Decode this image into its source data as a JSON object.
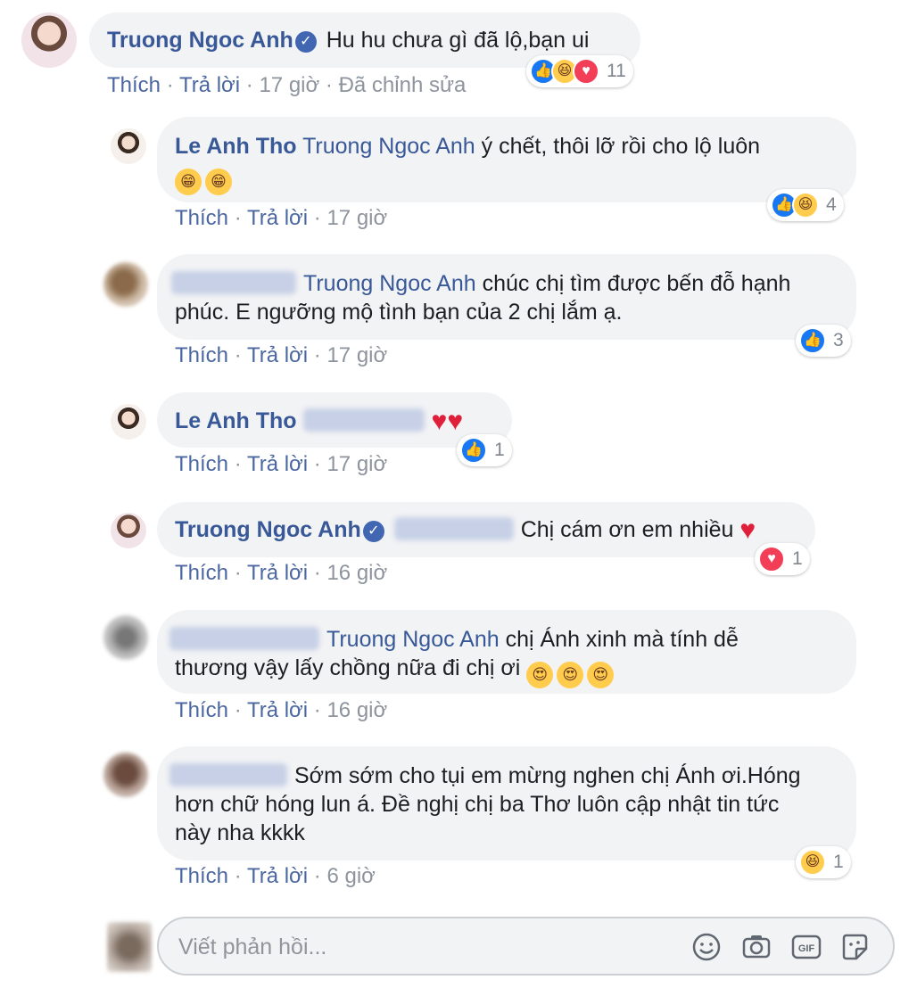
{
  "comments": [
    {
      "author": "Truong Ngoc Anh",
      "verified": true,
      "text": "Hu hu chưa gì đã lộ,bạn ui",
      "like_label": "Thích",
      "reply_label": "Trả lời",
      "time": "17 giờ",
      "edited": "Đã chỉnh sửa",
      "reactions": [
        "like",
        "haha",
        "love"
      ],
      "reaction_count": "11"
    },
    {
      "author": "Le Anh Tho",
      "mention": "Truong Ngoc Anh",
      "text": "ý chết, thôi lỡ rồi cho lộ luôn",
      "emojis": [
        "grin",
        "grin"
      ],
      "like_label": "Thích",
      "reply_label": "Trả lời",
      "time": "17 giờ",
      "reactions": [
        "like",
        "haha"
      ],
      "reaction_count": "4"
    },
    {
      "author_hidden": true,
      "mention": "Truong Ngoc Anh",
      "text_line1": "chúc chị tìm được bến đỗ hạnh",
      "text_line2": "phúc. E ngưỡng mộ tình bạn của 2 chị lắm ạ.",
      "like_label": "Thích",
      "reply_label": "Trả lời",
      "time": "17 giờ",
      "reactions": [
        "like"
      ],
      "reaction_count": "3"
    },
    {
      "author": "Le Anh Tho",
      "mention_hidden": true,
      "emojis": [
        "heart",
        "heart"
      ],
      "like_label": "Thích",
      "reply_label": "Trả lời",
      "time": "17 giờ",
      "reactions": [
        "like"
      ],
      "reaction_count": "1"
    },
    {
      "author": "Truong Ngoc Anh",
      "verified": true,
      "mention_hidden": true,
      "text": "Chị cám ơn em nhiều",
      "emojis": [
        "heart"
      ],
      "like_label": "Thích",
      "reply_label": "Trả lời",
      "time": "16 giờ",
      "reactions": [
        "love"
      ],
      "reaction_count": "1"
    },
    {
      "author_hidden": true,
      "mention": "Truong Ngoc Anh",
      "text_line1": "chị Ánh xinh mà tính dễ",
      "text_line2": "thương vậy lấy chồng nữa đi chị ơi",
      "emojis": [
        "heart-eyes",
        "heart-eyes",
        "heart-eyes"
      ],
      "like_label": "Thích",
      "reply_label": "Trả lời",
      "time": "16 giờ"
    },
    {
      "author_hidden": true,
      "text_line1": "Sớm sớm cho tụi em mừng nghen chị Ánh ơi.Hóng",
      "text_line2": "hơn chữ hóng lun á. Đề nghị chị ba Thơ luôn cập nhật tin tức",
      "text_line3": "này nha kkkk",
      "like_label": "Thích",
      "reply_label": "Trả lời",
      "time": "6 giờ",
      "reactions": [
        "haha"
      ],
      "reaction_count": "1"
    }
  ],
  "composer": {
    "placeholder": "Viết phản hồi...",
    "tools": [
      "emoji-icon",
      "camera-icon",
      "gif-icon",
      "sticker-icon"
    ]
  },
  "colors": {
    "link": "#385898",
    "bubble": "#f2f3f5",
    "meta": "#8d949e",
    "like": "#1877f2",
    "love": "#f33e58",
    "haha": "#ffcc4d"
  }
}
